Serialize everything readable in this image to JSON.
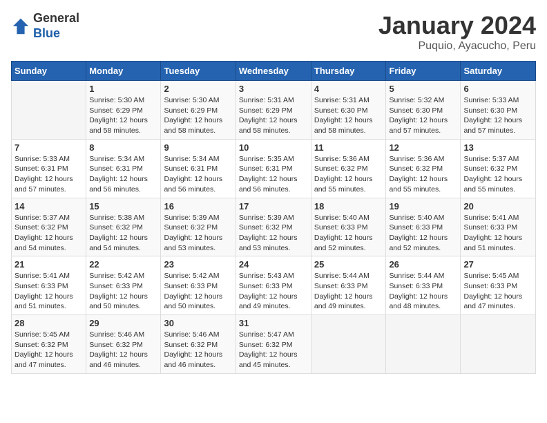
{
  "header": {
    "logo_general": "General",
    "logo_blue": "Blue",
    "month_title": "January 2024",
    "location": "Puquio, Ayacucho, Peru"
  },
  "days_of_week": [
    "Sunday",
    "Monday",
    "Tuesday",
    "Wednesday",
    "Thursday",
    "Friday",
    "Saturday"
  ],
  "weeks": [
    [
      {
        "day": "",
        "info": ""
      },
      {
        "day": "1",
        "info": "Sunrise: 5:30 AM\nSunset: 6:29 PM\nDaylight: 12 hours\nand 58 minutes."
      },
      {
        "day": "2",
        "info": "Sunrise: 5:30 AM\nSunset: 6:29 PM\nDaylight: 12 hours\nand 58 minutes."
      },
      {
        "day": "3",
        "info": "Sunrise: 5:31 AM\nSunset: 6:29 PM\nDaylight: 12 hours\nand 58 minutes."
      },
      {
        "day": "4",
        "info": "Sunrise: 5:31 AM\nSunset: 6:30 PM\nDaylight: 12 hours\nand 58 minutes."
      },
      {
        "day": "5",
        "info": "Sunrise: 5:32 AM\nSunset: 6:30 PM\nDaylight: 12 hours\nand 57 minutes."
      },
      {
        "day": "6",
        "info": "Sunrise: 5:33 AM\nSunset: 6:30 PM\nDaylight: 12 hours\nand 57 minutes."
      }
    ],
    [
      {
        "day": "7",
        "info": "Sunrise: 5:33 AM\nSunset: 6:31 PM\nDaylight: 12 hours\nand 57 minutes."
      },
      {
        "day": "8",
        "info": "Sunrise: 5:34 AM\nSunset: 6:31 PM\nDaylight: 12 hours\nand 56 minutes."
      },
      {
        "day": "9",
        "info": "Sunrise: 5:34 AM\nSunset: 6:31 PM\nDaylight: 12 hours\nand 56 minutes."
      },
      {
        "day": "10",
        "info": "Sunrise: 5:35 AM\nSunset: 6:31 PM\nDaylight: 12 hours\nand 56 minutes."
      },
      {
        "day": "11",
        "info": "Sunrise: 5:36 AM\nSunset: 6:32 PM\nDaylight: 12 hours\nand 55 minutes."
      },
      {
        "day": "12",
        "info": "Sunrise: 5:36 AM\nSunset: 6:32 PM\nDaylight: 12 hours\nand 55 minutes."
      },
      {
        "day": "13",
        "info": "Sunrise: 5:37 AM\nSunset: 6:32 PM\nDaylight: 12 hours\nand 55 minutes."
      }
    ],
    [
      {
        "day": "14",
        "info": "Sunrise: 5:37 AM\nSunset: 6:32 PM\nDaylight: 12 hours\nand 54 minutes."
      },
      {
        "day": "15",
        "info": "Sunrise: 5:38 AM\nSunset: 6:32 PM\nDaylight: 12 hours\nand 54 minutes."
      },
      {
        "day": "16",
        "info": "Sunrise: 5:39 AM\nSunset: 6:32 PM\nDaylight: 12 hours\nand 53 minutes."
      },
      {
        "day": "17",
        "info": "Sunrise: 5:39 AM\nSunset: 6:32 PM\nDaylight: 12 hours\nand 53 minutes."
      },
      {
        "day": "18",
        "info": "Sunrise: 5:40 AM\nSunset: 6:33 PM\nDaylight: 12 hours\nand 52 minutes."
      },
      {
        "day": "19",
        "info": "Sunrise: 5:40 AM\nSunset: 6:33 PM\nDaylight: 12 hours\nand 52 minutes."
      },
      {
        "day": "20",
        "info": "Sunrise: 5:41 AM\nSunset: 6:33 PM\nDaylight: 12 hours\nand 51 minutes."
      }
    ],
    [
      {
        "day": "21",
        "info": "Sunrise: 5:41 AM\nSunset: 6:33 PM\nDaylight: 12 hours\nand 51 minutes."
      },
      {
        "day": "22",
        "info": "Sunrise: 5:42 AM\nSunset: 6:33 PM\nDaylight: 12 hours\nand 50 minutes."
      },
      {
        "day": "23",
        "info": "Sunrise: 5:42 AM\nSunset: 6:33 PM\nDaylight: 12 hours\nand 50 minutes."
      },
      {
        "day": "24",
        "info": "Sunrise: 5:43 AM\nSunset: 6:33 PM\nDaylight: 12 hours\nand 49 minutes."
      },
      {
        "day": "25",
        "info": "Sunrise: 5:44 AM\nSunset: 6:33 PM\nDaylight: 12 hours\nand 49 minutes."
      },
      {
        "day": "26",
        "info": "Sunrise: 5:44 AM\nSunset: 6:33 PM\nDaylight: 12 hours\nand 48 minutes."
      },
      {
        "day": "27",
        "info": "Sunrise: 5:45 AM\nSunset: 6:33 PM\nDaylight: 12 hours\nand 47 minutes."
      }
    ],
    [
      {
        "day": "28",
        "info": "Sunrise: 5:45 AM\nSunset: 6:32 PM\nDaylight: 12 hours\nand 47 minutes."
      },
      {
        "day": "29",
        "info": "Sunrise: 5:46 AM\nSunset: 6:32 PM\nDaylight: 12 hours\nand 46 minutes."
      },
      {
        "day": "30",
        "info": "Sunrise: 5:46 AM\nSunset: 6:32 PM\nDaylight: 12 hours\nand 46 minutes."
      },
      {
        "day": "31",
        "info": "Sunrise: 5:47 AM\nSunset: 6:32 PM\nDaylight: 12 hours\nand 45 minutes."
      },
      {
        "day": "",
        "info": ""
      },
      {
        "day": "",
        "info": ""
      },
      {
        "day": "",
        "info": ""
      }
    ]
  ]
}
